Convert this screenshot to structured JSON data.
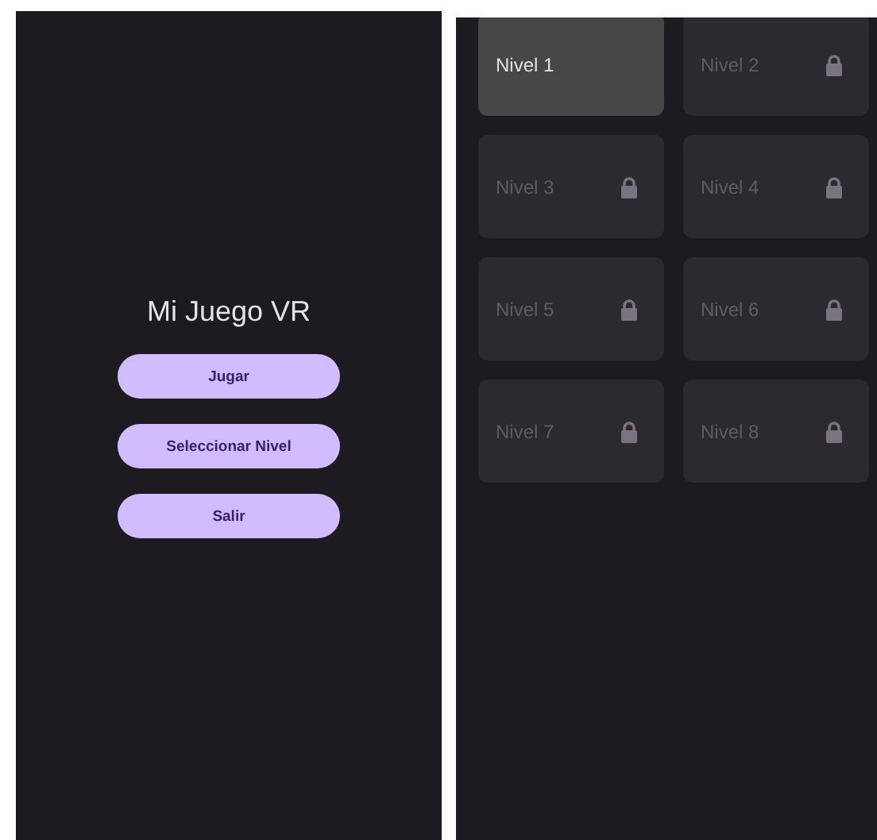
{
  "main_menu": {
    "title": "Mi Juego VR",
    "buttons": [
      "Jugar",
      "Seleccionar Nivel",
      "Salir"
    ]
  },
  "levels": [
    {
      "label": "Nivel 1",
      "locked": false
    },
    {
      "label": "Nivel 2",
      "locked": true
    },
    {
      "label": "Nivel 3",
      "locked": true
    },
    {
      "label": "Nivel 4",
      "locked": true
    },
    {
      "label": "Nivel 5",
      "locked": true
    },
    {
      "label": "Nivel 6",
      "locked": true
    },
    {
      "label": "Nivel 7",
      "locked": true
    },
    {
      "label": "Nivel 8",
      "locked": true
    }
  ]
}
